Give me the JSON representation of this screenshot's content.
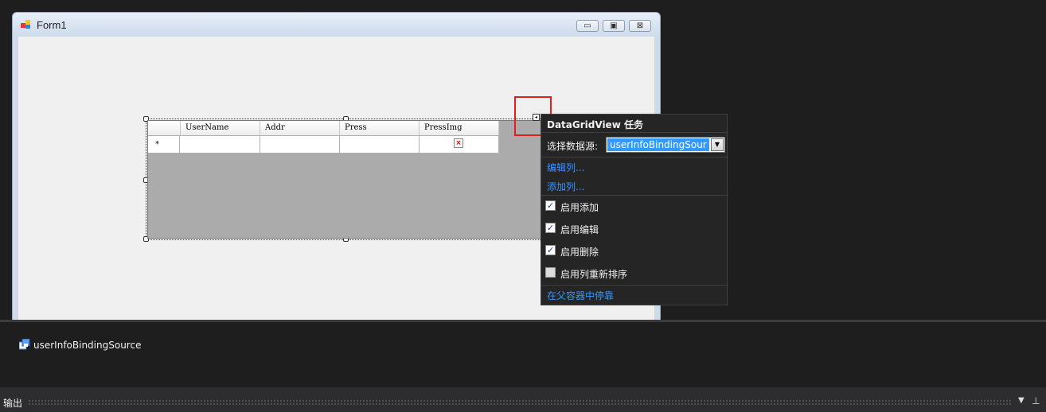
{
  "form": {
    "title": "Form1",
    "caption_buttons": {
      "minimize": "▭",
      "maximize": "▣",
      "close": "⊠"
    }
  },
  "grid": {
    "columns": [
      "UserName",
      "Addr",
      "Press",
      "PressImg"
    ],
    "new_row_glyph": "*",
    "image_placeholder": "×"
  },
  "smart_tag": {
    "glyph": "◂"
  },
  "tasks_panel": {
    "title": "DataGridView 任务",
    "datasource_label": "选择数据源:",
    "datasource_value": "userInfoBindingSour",
    "dropdown_glyph": "▼",
    "links": {
      "edit_columns": "编辑列...",
      "add_column": "添加列..."
    },
    "options": [
      {
        "label": "启用添加",
        "checked": true
      },
      {
        "label": "启用编辑",
        "checked": true
      },
      {
        "label": "启用删除",
        "checked": true
      },
      {
        "label": "启用列重新排序",
        "checked": false
      }
    ],
    "dock_link": "在父容器中停靠",
    "check_glyph": "✓"
  },
  "component_tray": {
    "items": [
      {
        "label": "userInfoBindingSource",
        "icon": "binding-source-icon"
      }
    ]
  },
  "output_panel": {
    "title": "输出",
    "dropdown_glyph": "▼",
    "pin_glyph": "⊥"
  }
}
